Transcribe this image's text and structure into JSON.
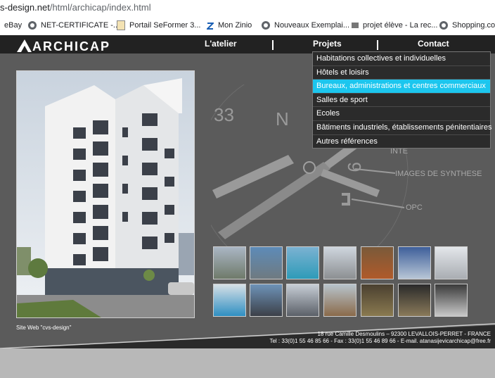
{
  "browser": {
    "url_domain": "s-design.net",
    "url_path": "/html/archicap/index.html",
    "bookmarks": [
      {
        "label": "eBay",
        "icon": "none"
      },
      {
        "label": "NET-CERTIFICATE -...",
        "icon": "globe-icon"
      },
      {
        "label": "Portail SeFormer  3...",
        "icon": "portal-icon"
      },
      {
        "label": "Mon Zinio",
        "icon": "zinio-icon"
      },
      {
        "label": "Nouveaux Exemplai...",
        "icon": "globe-icon"
      },
      {
        "label": "projet élève - La rec...",
        "icon": "school-icon"
      },
      {
        "label": "Shopping.com",
        "icon": "globe-icon"
      }
    ]
  },
  "site": {
    "logo": "ARCHICAP",
    "nav": {
      "atelier": "L'atelier",
      "projets": "Projets",
      "contact": "Contact"
    },
    "dropdown": [
      "Habitations collectives et individuelles",
      "Hôtels et loisirs",
      "Bureaux, administrations et centres commerciaux",
      "Salles de sport",
      "Ecoles",
      "Bâtiments industriels, établissements pénitentiaires",
      "Autres références"
    ],
    "dropdown_active_index": 2,
    "compass_labels": {
      "n": "33",
      "letter": "N",
      "nine": "9",
      "images": "IMAGES DE SYNTHESE",
      "opc": "OPC",
      "interieur": "INTE"
    },
    "footer_credit": "Site Web \"cvs-design\"",
    "address": "18 rue Camille Desmoulins – 92300 LEVALLOIS-PERRET - FRANCE",
    "contact_line": "Tel : 33(0)1 55 46 85 66 - Fax : 33(0)1 55 46 89 66 - E-mail. atanasijevicarchicap@free.fr"
  },
  "colors": {
    "accent": "#1cc6ee",
    "nav_bg": "#222222",
    "page_bg": "#5b5b5b"
  }
}
